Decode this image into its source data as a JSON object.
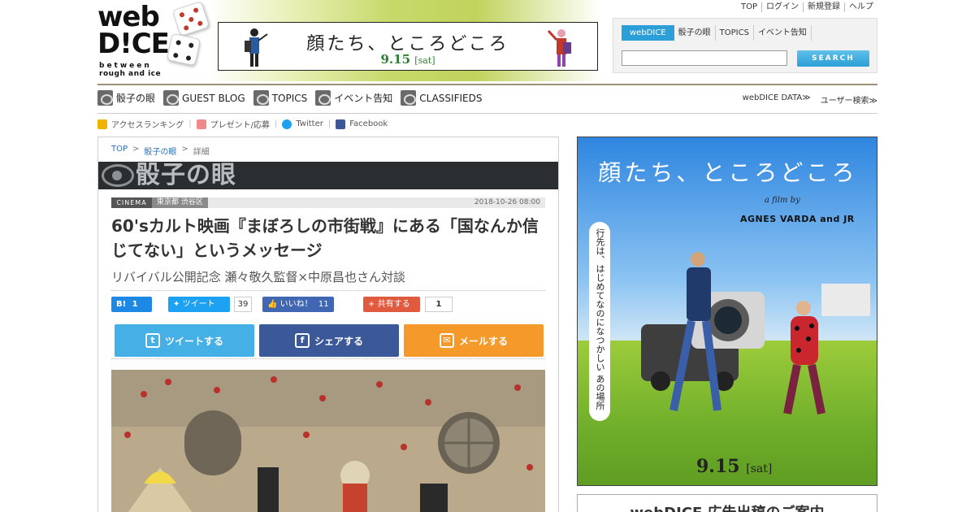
{
  "logo": {
    "word": "web",
    "dice": "D!CE",
    "tagline1": "between",
    "tagline2": "rough and ice"
  },
  "banner": {
    "title": "顔たち、ところどころ",
    "date": "9.15",
    "date_suffix": "[sat]"
  },
  "top_links": [
    "TOP",
    "ログイン",
    "新規登録",
    "ヘルプ"
  ],
  "search": {
    "tabs": [
      "webDICE",
      "骰子の眼",
      "TOPICS",
      "イベント告知"
    ],
    "active_tab": "webDICE",
    "placeholder": "",
    "button_label": "SEARCH"
  },
  "main_nav": [
    {
      "label": "骰子の眼",
      "icon": "eye-icon"
    },
    {
      "label": "GUEST BLOG",
      "icon": "guest-blog-icon"
    },
    {
      "label": "TOPICS",
      "icon": "topics-icon"
    },
    {
      "label": "イベント告知",
      "icon": "event-icon"
    },
    {
      "label": "CLASSIFIEDS",
      "icon": "classifieds-icon"
    }
  ],
  "sub_nav_right": [
    "webDICE DATA≫",
    "ユーザー検索≫"
  ],
  "mini_links": [
    {
      "label": "アクセスランキング",
      "icon": "crown-icon",
      "color": "#f0b400"
    },
    {
      "label": "プレゼント/応募",
      "icon": "gift-icon",
      "color": "#e66"
    },
    {
      "label": "Twitter",
      "icon": "twitter-icon",
      "color": "#1da1f2"
    },
    {
      "label": "Facebook",
      "icon": "facebook-icon",
      "color": "#3b5998"
    }
  ],
  "breadcrumb": [
    "TOP",
    "骰子の眼",
    "詳細"
  ],
  "section_title": "骰子の眼",
  "article": {
    "category": "CINEMA",
    "location": "東京都 渋谷区",
    "date": "2018-10-26 08:00",
    "title": "60'sカルト映画『まぼろしの市街戦』にある「国なんか信じてない」というメッセージ",
    "subtitle": "リバイバル公開記念 瀬々敬久監督×中原昌也さん対談"
  },
  "social": {
    "hatena_label": "B!",
    "hatena_count": "1",
    "tweet_label": "ツイート",
    "tweet_count": "39",
    "like_label": "いいね！",
    "like_count": "11",
    "share_label": "共有する",
    "share_count": "1"
  },
  "share_buttons": {
    "tweet": "ツイートする",
    "facebook": "シェアする",
    "mail": "メールする"
  },
  "sidebar_ad": {
    "title": "顔たち、ところどころ",
    "film_by": "a film by",
    "credit": "AGNES VARDA and JR",
    "vertical_copy": "行先は、はじめてなのになつかしい あの場所",
    "date": "9.15",
    "date_suffix": "[sat]"
  },
  "sidebar_ad2": {
    "text": "webDICE 広告出稿のご案内"
  },
  "colors": {
    "accent": "#2b9fd7",
    "twitter": "#45b0e5",
    "facebook": "#3b5998",
    "mail": "#f59a2a"
  }
}
